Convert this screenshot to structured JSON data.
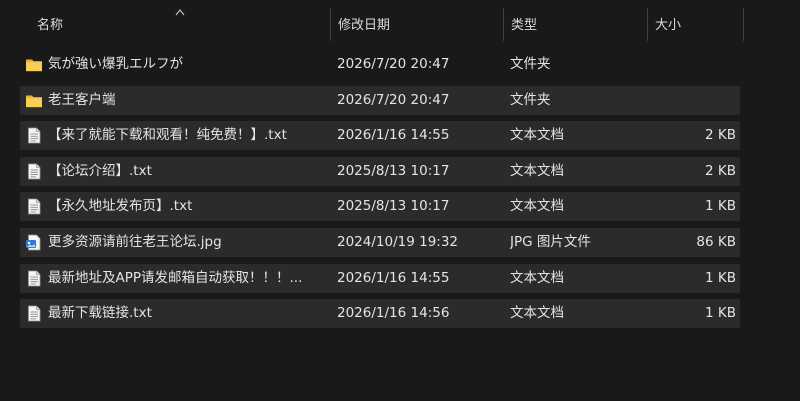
{
  "columns": {
    "name": "名称",
    "date": "修改日期",
    "type": "类型",
    "size": "大小"
  },
  "files": [
    {
      "name": "気が強い爆乳エルフが",
      "date": "2026/7/20 20:47",
      "type": "文件夹",
      "size": "",
      "icon": "folder-icon"
    },
    {
      "name": "老王客户端",
      "date": "2026/7/20 20:47",
      "type": "文件夹",
      "size": "",
      "icon": "folder-icon"
    },
    {
      "name": "【来了就能下载和观看！纯免费！】.txt",
      "date": "2026/1/16 14:55",
      "type": "文本文档",
      "size": "2 KB",
      "icon": "text-file-icon"
    },
    {
      "name": "【论坛介绍】.txt",
      "date": "2025/8/13 10:17",
      "type": "文本文档",
      "size": "2 KB",
      "icon": "text-file-icon"
    },
    {
      "name": "【永久地址发布页】.txt",
      "date": "2025/8/13 10:17",
      "type": "文本文档",
      "size": "1 KB",
      "icon": "text-file-icon"
    },
    {
      "name": "更多资源请前往老王论坛.jpg",
      "date": "2024/10/19 19:32",
      "type": "JPG 图片文件",
      "size": "86 KB",
      "icon": "image-file-icon"
    },
    {
      "name": "最新地址及APP请发邮箱自动获取！！！...",
      "date": "2026/1/16 14:55",
      "type": "文本文档",
      "size": "1 KB",
      "icon": "text-file-icon"
    },
    {
      "name": "最新下载链接.txt",
      "date": "2026/1/16 14:56",
      "type": "文本文档",
      "size": "1 KB",
      "icon": "text-file-icon"
    }
  ],
  "colors": {
    "background": "#191919",
    "row": "#2b2b2b",
    "folder": "#f4c542"
  }
}
